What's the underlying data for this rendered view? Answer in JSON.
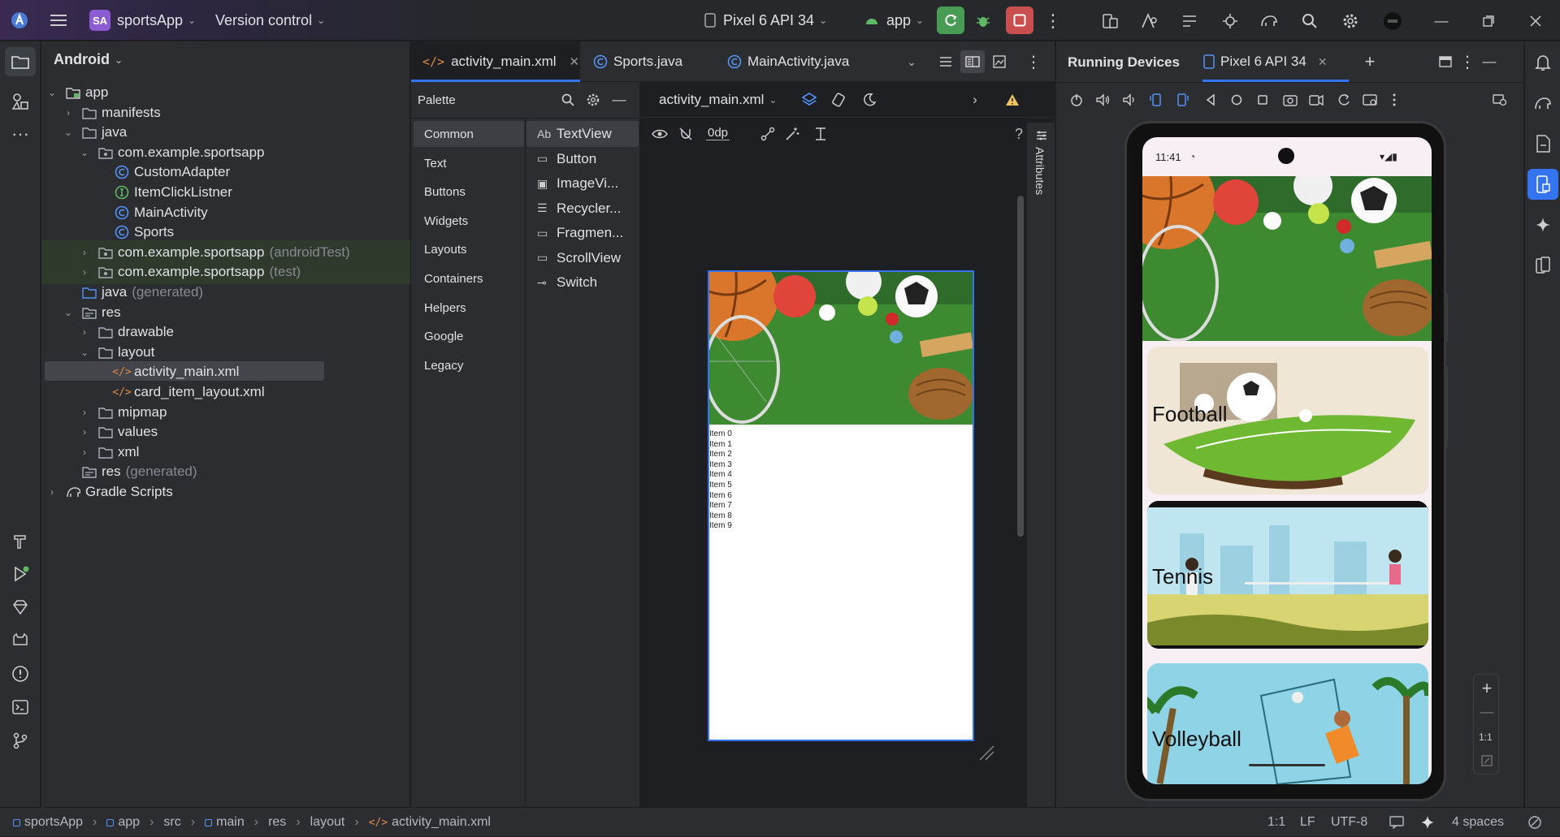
{
  "titlebar": {
    "project_badge": "SA",
    "project_name": "sportsApp",
    "vcs": "Version control",
    "device": "Pixel 6 API 34",
    "run_config": "app"
  },
  "project_panel": {
    "view_mode": "Android",
    "tree": [
      {
        "label": "app",
        "suffix": ""
      },
      {
        "label": "manifests",
        "suffix": ""
      },
      {
        "label": "java",
        "suffix": ""
      },
      {
        "label": "com.example.sportsapp",
        "suffix": ""
      },
      {
        "label": "CustomAdapter",
        "suffix": ""
      },
      {
        "label": "ItemClickListner",
        "suffix": ""
      },
      {
        "label": "MainActivity",
        "suffix": ""
      },
      {
        "label": "Sports",
        "suffix": ""
      },
      {
        "label": "com.example.sportsapp",
        "suffix": "(androidTest)"
      },
      {
        "label": "com.example.sportsapp",
        "suffix": "(test)"
      },
      {
        "label": "java",
        "suffix": "(generated)"
      },
      {
        "label": "res",
        "suffix": ""
      },
      {
        "label": "drawable",
        "suffix": ""
      },
      {
        "label": "layout",
        "suffix": ""
      },
      {
        "label": "activity_main.xml",
        "suffix": ""
      },
      {
        "label": "card_item_layout.xml",
        "suffix": ""
      },
      {
        "label": "mipmap",
        "suffix": ""
      },
      {
        "label": "values",
        "suffix": ""
      },
      {
        "label": "xml",
        "suffix": ""
      },
      {
        "label": "res",
        "suffix": "(generated)"
      },
      {
        "label": "Gradle Scripts",
        "suffix": ""
      }
    ]
  },
  "editor": {
    "tabs": [
      "activity_main.xml",
      "Sports.java",
      "MainActivity.java"
    ],
    "palette_title": "Palette",
    "palette_categories": [
      "Common",
      "Text",
      "Buttons",
      "Widgets",
      "Layouts",
      "Containers",
      "Helpers",
      "Google",
      "Legacy"
    ],
    "palette_items": [
      {
        "icon": "Ab",
        "label": "TextView"
      },
      {
        "icon": "button-widget-icon",
        "label": "Button"
      },
      {
        "icon": "imageview-icon",
        "label": "ImageVi..."
      },
      {
        "icon": "recyclerview-icon",
        "label": "Recycler..."
      },
      {
        "icon": "fragment-icon",
        "label": "Fragmen..."
      },
      {
        "icon": "scrollview-icon",
        "label": "ScrollView"
      },
      {
        "icon": "switch-icon",
        "label": "Switch"
      }
    ],
    "design_file": "activity_main.xml",
    "margin_value": "0dp",
    "attributes_label": "Attributes",
    "preview_items": [
      "Item 0",
      "Item 1",
      "Item 2",
      "Item 3",
      "Item 4",
      "Item 5",
      "Item 6",
      "Item 7",
      "Item 8",
      "Item 9"
    ]
  },
  "running_devices": {
    "title": "Running Devices",
    "device_tab": "Pixel 6 API 34",
    "phone_time": "11:41",
    "zoom_label": "1:1",
    "cards": [
      "Football",
      "Tennis",
      "Volleyball"
    ]
  },
  "statusbar": {
    "breadcrumb": [
      "sportsApp",
      "app",
      "src",
      "main",
      "res",
      "layout",
      "activity_main.xml"
    ],
    "position": "1:1",
    "line_ending": "LF",
    "encoding": "UTF-8",
    "indent": "4 spaces"
  },
  "colors": {
    "accent": "#3574f0",
    "run_green": "#499c54",
    "stop_red": "#c94f4f",
    "warning": "#f2c55c",
    "panel_bg": "#2b2d30",
    "editor_bg": "#1e1f22"
  }
}
